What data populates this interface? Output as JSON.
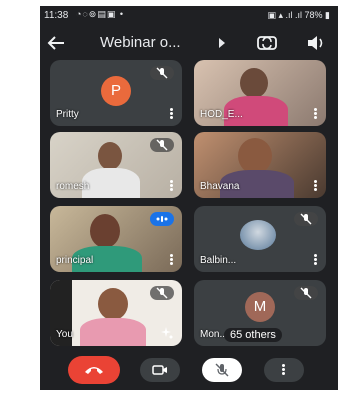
{
  "status": {
    "time": "11:38",
    "battery": "78%"
  },
  "header": {
    "title": "Webinar o..."
  },
  "participants": [
    {
      "name": "Pritty",
      "initial": "P"
    },
    {
      "name": "HOD_E..."
    },
    {
      "name": "romesh"
    },
    {
      "name": "Bhavana"
    },
    {
      "name": "principal"
    },
    {
      "name": "Balbin..."
    },
    {
      "name": "You"
    },
    {
      "name": "Mon...",
      "initial": "M",
      "others": "65 others"
    }
  ],
  "colors": {
    "end_call": "#ea4335",
    "pritty_avatar": "#ea6a3c",
    "others_avatar": "#a06858",
    "active_speaker": "#1a73e8"
  }
}
